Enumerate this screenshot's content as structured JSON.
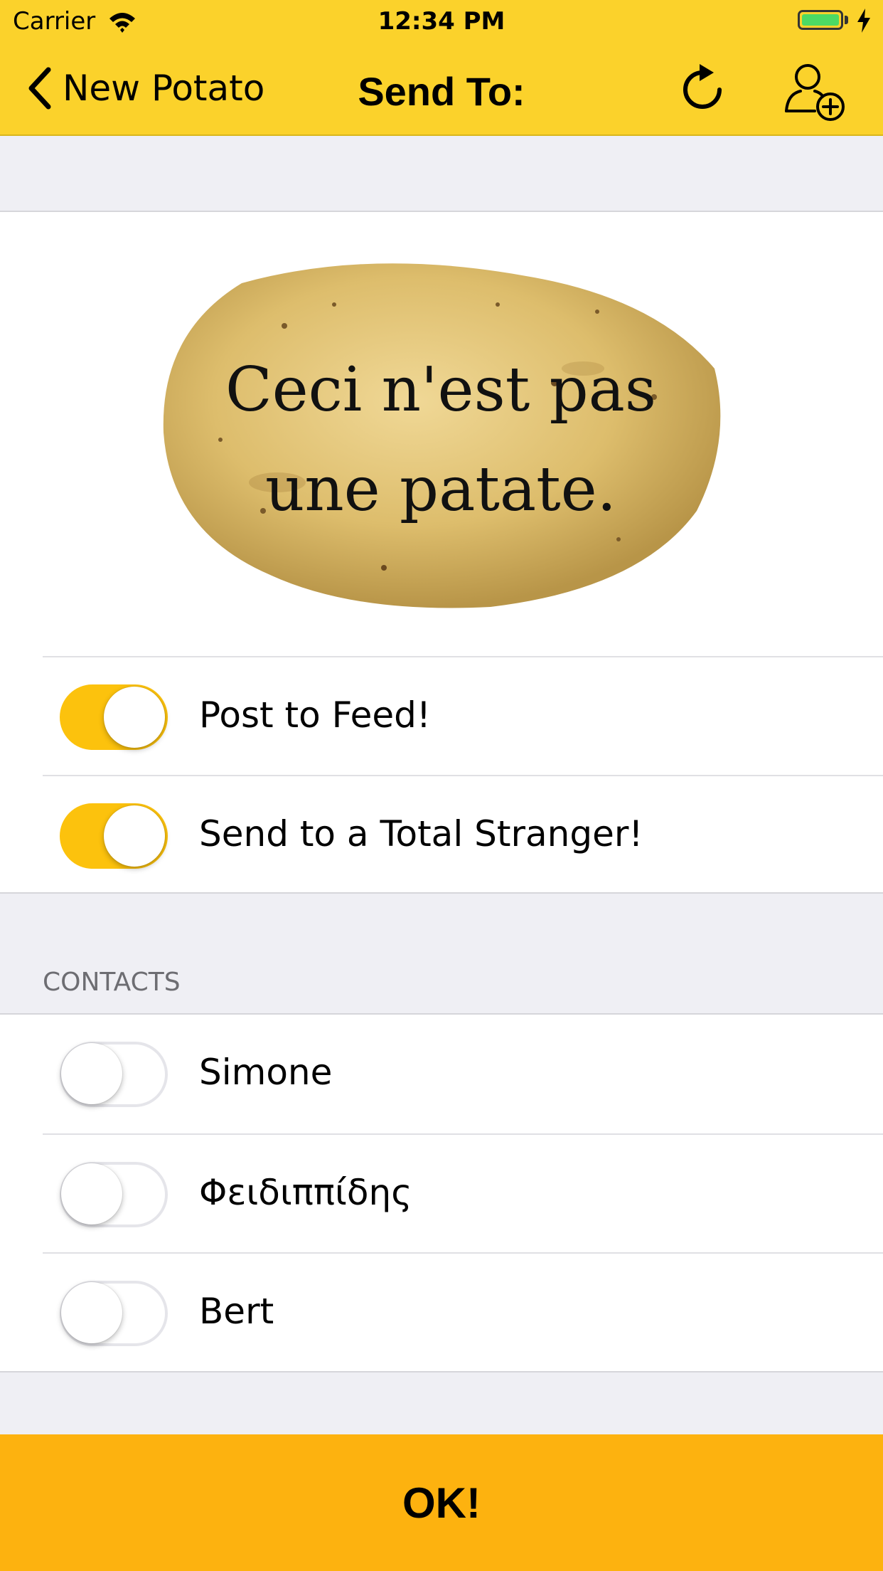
{
  "status_bar": {
    "carrier": "Carrier",
    "time": "12:34 PM"
  },
  "nav": {
    "back_label": "New Potato",
    "title": "Send To:",
    "refresh_icon": "refresh-icon",
    "add_contact_icon": "add-contact-icon"
  },
  "potato": {
    "line1": "Ceci n'est pas",
    "line2": "une patate."
  },
  "options": [
    {
      "label": "Post to Feed!",
      "on": true
    },
    {
      "label": "Send to a Total Stranger!",
      "on": true
    }
  ],
  "contacts": {
    "header": "CONTACTS",
    "items": [
      {
        "name": "Simone",
        "on": false
      },
      {
        "name": "Φειδιππίδης",
        "on": false
      },
      {
        "name": "Bert",
        "on": false
      }
    ]
  },
  "ok_label": "OK!",
  "colors": {
    "nav_yellow": "#fbd22b",
    "switch_on": "#fcc20d",
    "ok_orange": "#fdb20f",
    "background": "#efeff4"
  }
}
